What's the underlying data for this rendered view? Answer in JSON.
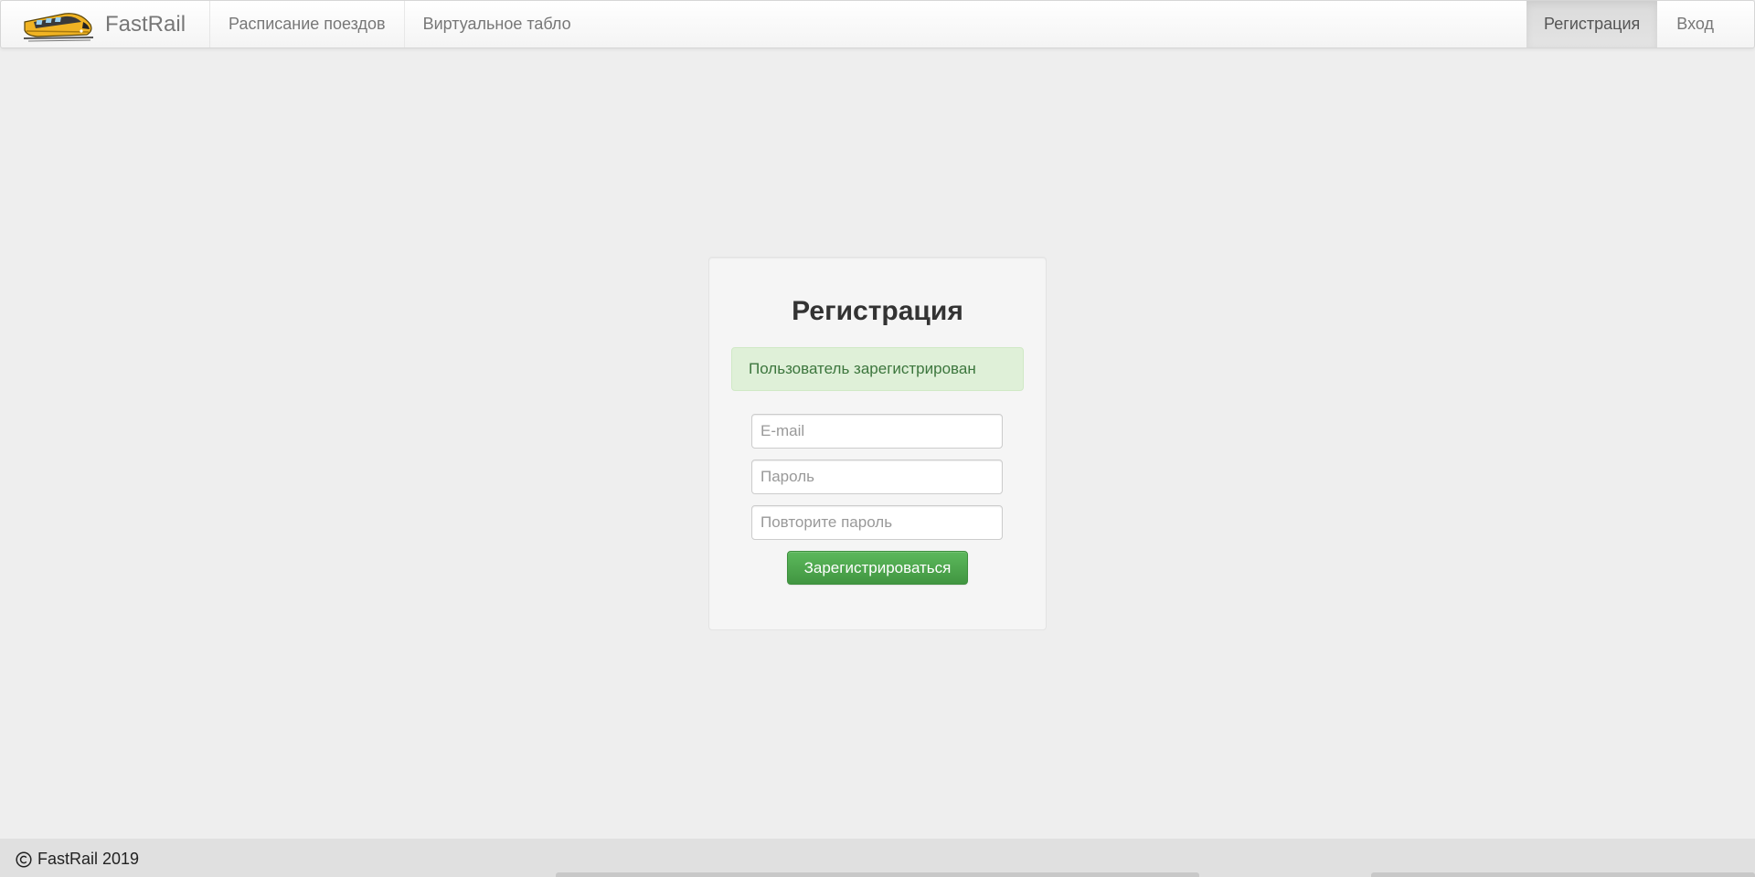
{
  "navbar": {
    "brand": "FastRail",
    "links": [
      "Расписание поездов",
      "Виртуальное табло"
    ],
    "register": "Регистрация",
    "login": "Вход"
  },
  "form": {
    "title": "Регистрация",
    "alert": "Пользователь зарегистрирован",
    "email_placeholder": "E-mail",
    "password_placeholder": "Пароль",
    "repeat_placeholder": "Повторите пароль",
    "submit": "Зарегистрироваться"
  },
  "footer": {
    "copyright": "FastRail 2019"
  },
  "icons": {
    "logo": "train-logo-icon",
    "copyright": "copyright-icon"
  },
  "colors": {
    "success_bg": "#dff0d8",
    "success_text": "#3c763d",
    "button": "#5cb85c",
    "train": "#f0b323"
  }
}
